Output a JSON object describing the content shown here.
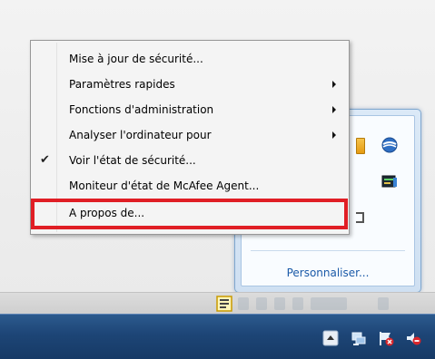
{
  "context_menu": {
    "items": [
      {
        "label": "Mise à jour de sécurité...",
        "has_submenu": false,
        "checked": false
      },
      {
        "label": "Paramètres rapides",
        "has_submenu": true,
        "checked": false
      },
      {
        "label": "Fonctions d'administration",
        "has_submenu": true,
        "checked": false
      },
      {
        "label": "Analyser l'ordinateur pour",
        "has_submenu": true,
        "checked": false
      },
      {
        "label": "Voir l'état de sécurité...",
        "has_submenu": false,
        "checked": true
      },
      {
        "label": "Moniteur d'état de McAfee Agent...",
        "has_submenu": false,
        "checked": false
      },
      {
        "label": "A propos de...",
        "has_submenu": false,
        "checked": false
      }
    ],
    "check_glyph": "✔",
    "highlighted_item": "A propos de...",
    "highlight_color": "#e01e25"
  },
  "tray_flyout": {
    "customize_link": "Personnaliser...",
    "icons": [
      "yellow-app-icon",
      "globe-icon",
      "monitor-icon",
      "partial-icon"
    ]
  },
  "taskbar": {
    "tray_icons": [
      "show-hidden-icons-icon",
      "network-icon",
      "action-center-flag-icon",
      "volume-muted-icon"
    ],
    "strip_icons": [
      "mcafee-tray-icon"
    ]
  },
  "colors": {
    "taskbar": "#1d4576",
    "link": "#1b5aa8",
    "highlight": "#e01e25"
  }
}
